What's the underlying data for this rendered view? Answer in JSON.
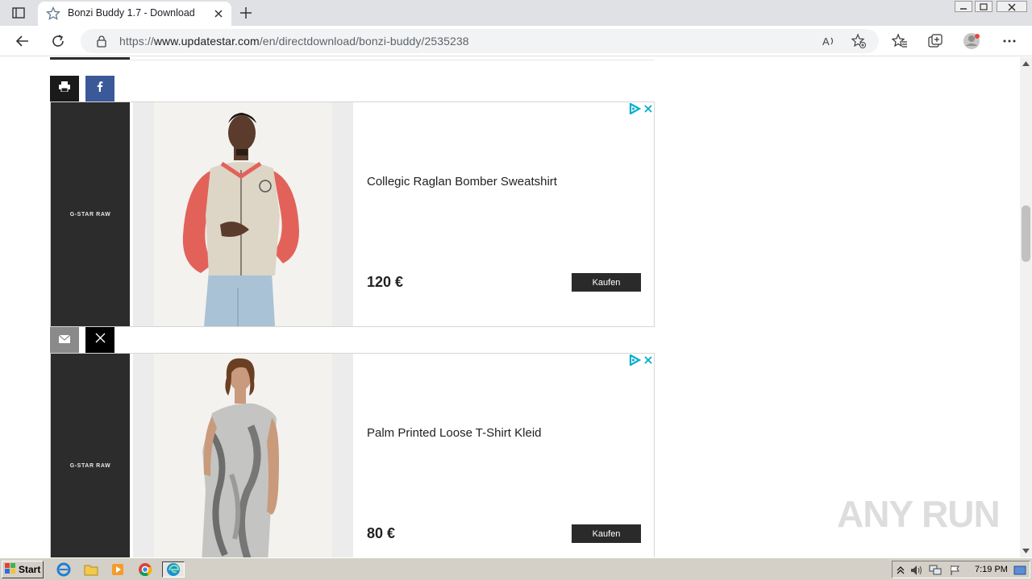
{
  "browser": {
    "tab_title": "Bonzi Buddy 1.7 - Download",
    "url_scheme": "https://",
    "url_host": "www.updatestar.com",
    "url_path": "/en/directdownload/bonzi-buddy/2535238"
  },
  "ads": [
    {
      "brand": "G-STAR RAW",
      "title": "Collegic Raglan Bomber Sweatshirt",
      "price": "120 €",
      "buy_label": "Kaufen"
    },
    {
      "brand": "G-STAR RAW",
      "title": "Palm Printed Loose T-Shirt Kleid",
      "price": "80 €",
      "buy_label": "Kaufen"
    }
  ],
  "share_buttons": [
    "print-icon",
    "facebook-icon",
    "email-icon",
    "x-icon"
  ],
  "watermark": "ANY RUN",
  "taskbar": {
    "start_label": "Start",
    "clock": "7:19 PM"
  },
  "colors": {
    "facebook": "#3b5998",
    "ad_choices": "#00aecd",
    "ad_panel": "#2c2c2c"
  }
}
